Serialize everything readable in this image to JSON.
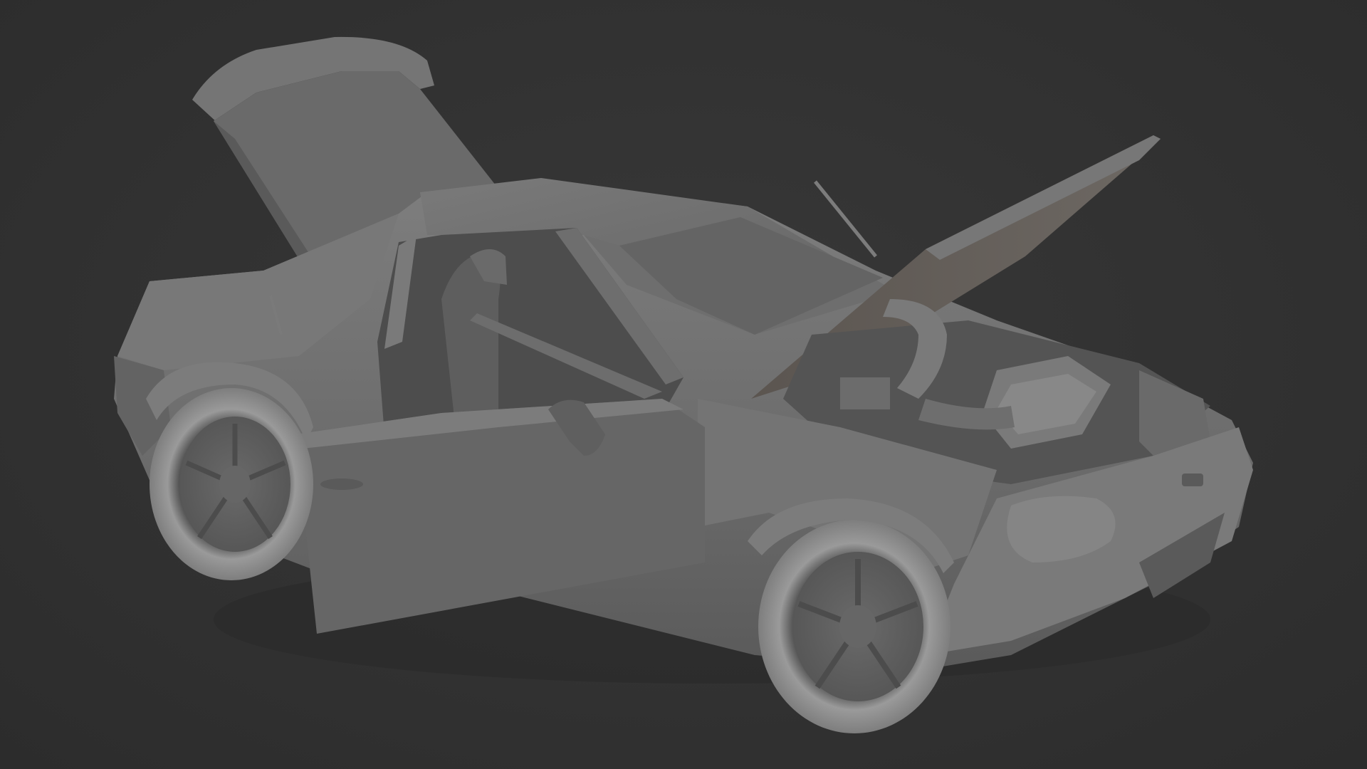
{
  "viewport": {
    "background_color": "#303030",
    "model_color": "#6f6f6f",
    "model_shadow_color": "#4a4a4a",
    "model_highlight_color": "#8a8a8a",
    "hood_underside_color": "#5d5650"
  },
  "model": {
    "subject": "car-3d-model",
    "parts_open": [
      "trunk-lid",
      "hood",
      "driver-door"
    ]
  }
}
